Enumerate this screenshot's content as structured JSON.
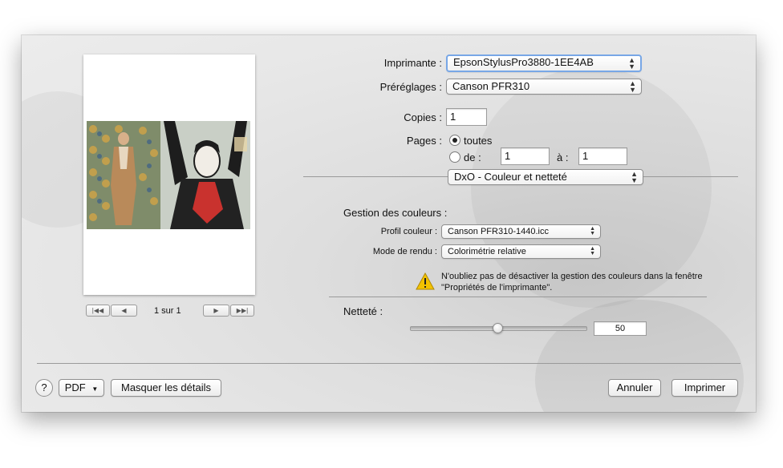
{
  "printer": {
    "label": "Imprimante :",
    "value": "EpsonStylusPro3880-1EE4AB"
  },
  "presets": {
    "label": "Préréglages :",
    "value": "Canson PFR310"
  },
  "copies": {
    "label": "Copies :",
    "value": "1"
  },
  "pages": {
    "label": "Pages :",
    "all_label": "toutes",
    "from_label": "de :",
    "from_value": "1",
    "to_label": "à :",
    "to_value": "1",
    "selected": "all"
  },
  "panel_selector": {
    "value": "DxO - Couleur et netteté"
  },
  "color_management": {
    "title": "Gestion des couleurs :",
    "profile_label": "Profil couleur :",
    "profile_value": "Canson PFR310-1440.icc",
    "render_label": "Mode de rendu :",
    "render_value": "Colorimétrie relative",
    "warning_text": "N'oubliez pas de désactiver la gestion des couleurs dans la fenêtre \"Propriétés de l'imprimante\"."
  },
  "sharpness": {
    "label": "Netteté :",
    "value": "50",
    "fraction": 0.5
  },
  "preview": {
    "page_indicator": "1 sur 1"
  },
  "footer": {
    "help_label": "?",
    "pdf_label": "PDF",
    "details_label": "Masquer les détails",
    "cancel_label": "Annuler",
    "print_label": "Imprimer"
  },
  "icons": [
    "first-page-icon",
    "prev-page-icon",
    "next-page-icon",
    "last-page-icon",
    "warning-icon",
    "chevron-updown-icon",
    "triangle-down-icon"
  ],
  "colors": {
    "focus_ring": "#78a7e6",
    "warning": "#f2c200"
  }
}
